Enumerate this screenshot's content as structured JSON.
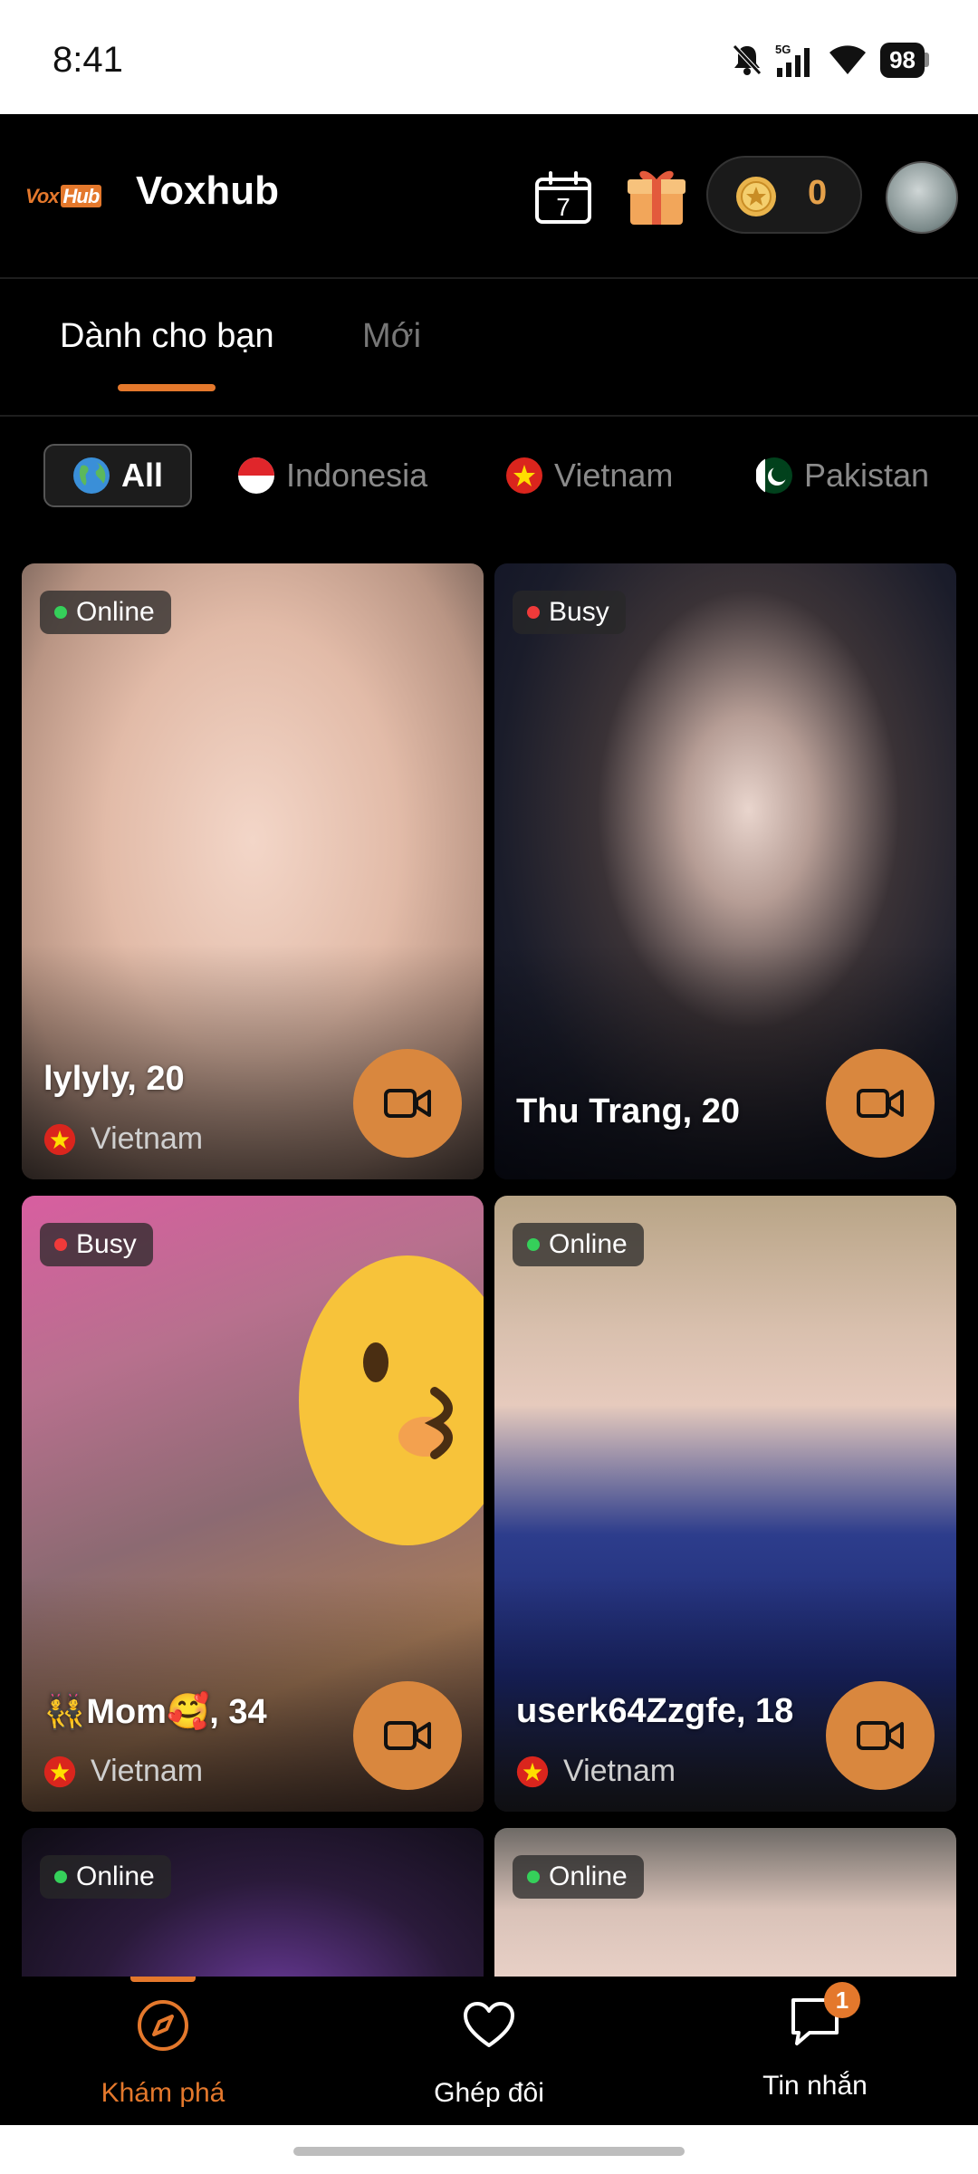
{
  "status_bar": {
    "time": "8:41",
    "battery": "98",
    "network": "5G"
  },
  "header": {
    "logo_vox": "Vox",
    "logo_hub": "Hub",
    "title": "Voxhub",
    "calendar_day": "7",
    "coins": "0"
  },
  "tabs": [
    {
      "label": "Dành cho bạn",
      "active": true
    },
    {
      "label": "Mới",
      "active": false
    }
  ],
  "filters": [
    {
      "label": "All",
      "flag": "globe-icon",
      "active": true
    },
    {
      "label": "Indonesia",
      "flag": "indonesia-flag-icon",
      "active": false
    },
    {
      "label": "Vietnam",
      "flag": "vietnam-flag-icon",
      "active": false
    },
    {
      "label": "Pakistan",
      "flag": "pakistan-flag-icon",
      "active": false
    }
  ],
  "cards": [
    {
      "status": "Online",
      "name": "lylyly, 20",
      "country": "Vietnam"
    },
    {
      "status": "Busy",
      "name": "Thu Trang, 20",
      "country": ""
    },
    {
      "status": "Busy",
      "name": "👯Mom🥰, 34",
      "country": "Vietnam"
    },
    {
      "status": "Online",
      "name": "userk64Zzgfe, 18",
      "country": "Vietnam"
    },
    {
      "status": "Online",
      "name": "",
      "country": ""
    },
    {
      "status": "Online",
      "name": "",
      "country": ""
    }
  ],
  "bottom_nav": [
    {
      "label": "Khám phá",
      "active": true,
      "icon": "compass-icon"
    },
    {
      "label": "Ghép đôi",
      "active": false,
      "icon": "heart-icon"
    },
    {
      "label": "Tin nhắn",
      "active": false,
      "icon": "message-icon",
      "badge": "1"
    }
  ],
  "colors": {
    "accent": "#e4782c",
    "online": "#35d05a",
    "busy": "#ef3a3a"
  }
}
